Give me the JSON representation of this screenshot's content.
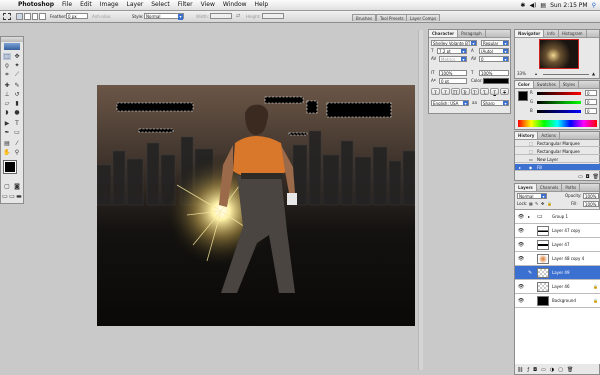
{
  "menubar": {
    "app_name": "Photoshop",
    "items": [
      "File",
      "Edit",
      "Image",
      "Layer",
      "Select",
      "Filter",
      "View",
      "Window",
      "Help"
    ],
    "clock": "Sun 2:15 PM"
  },
  "options_bar": {
    "feather_label": "Feather:",
    "feather_value": "0 px",
    "anti_alias_label": "Anti-alias",
    "style_label": "Style:",
    "style_value": "Normal",
    "width_label": "Width:",
    "height_label": "Height:",
    "dock_tabs": [
      "Brushes",
      "Tool Presets",
      "Layer Comps"
    ]
  },
  "character_panel": {
    "tabs": [
      "Character",
      "Paragraph"
    ],
    "font_family": "Shelley Volante BT",
    "font_style": "Regular",
    "font_size": "7.2 pt",
    "leading": "(Auto)",
    "kerning": "Metrics",
    "tracking": "0",
    "vscale": "100%",
    "hscale": "100%",
    "baseline": "0 pt",
    "color_label": "Color:",
    "language": "English: USA",
    "antialias": "Sharp",
    "style_buttons": [
      "T",
      "T",
      "TT",
      "Tr",
      "T'",
      "T,",
      "T",
      "T"
    ]
  },
  "navigator_panel": {
    "tabs": [
      "Navigator",
      "Info",
      "Histogram"
    ],
    "zoom": "33%"
  },
  "color_panel": {
    "tabs": [
      "Color",
      "Swatches",
      "Styles"
    ],
    "channels": [
      {
        "label": "R",
        "value": "0"
      },
      {
        "label": "G",
        "value": "0"
      },
      {
        "label": "B",
        "value": "0"
      }
    ]
  },
  "history_panel": {
    "tabs": [
      "History",
      "Actions"
    ],
    "items": [
      "Rectangular Marquee",
      "Rectangular Marquee",
      "New Layer",
      "Fill"
    ],
    "active_index": 3
  },
  "layers_panel": {
    "tabs": [
      "Layers",
      "Channels",
      "Paths"
    ],
    "blend_mode": "Normal",
    "opacity_label": "Opacity:",
    "opacity": "100%",
    "lock_label": "Lock:",
    "fill_label": "Fill:",
    "fill": "100%",
    "layers": [
      {
        "name": "Group 1",
        "visible": true,
        "kind": "group"
      },
      {
        "name": "Layer 47 copy",
        "visible": true,
        "kind": "layer"
      },
      {
        "name": "Layer 47",
        "visible": true,
        "kind": "layer"
      },
      {
        "name": "Layer 48 copy 4",
        "visible": true,
        "kind": "layer"
      },
      {
        "name": "Layer 49",
        "visible": false,
        "kind": "layer"
      },
      {
        "name": "Layer 46",
        "visible": true,
        "kind": "layer"
      },
      {
        "name": "Background",
        "visible": true,
        "kind": "background"
      }
    ],
    "active_index": 4
  },
  "colors": {
    "selection": "#3b6fd0",
    "canvas_sky_top": "#6b5647",
    "skyline": "#2b2b2b",
    "energy_glow": "#f8e9a0",
    "shirt": "#d9782b"
  }
}
